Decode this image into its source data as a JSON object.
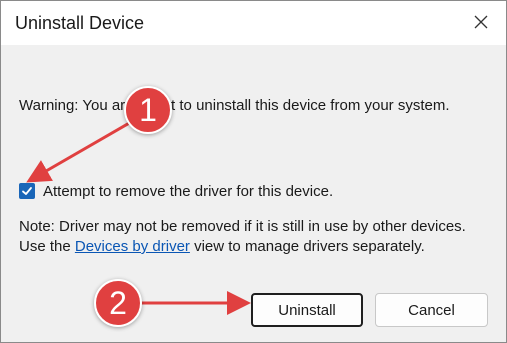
{
  "dialog": {
    "title": "Uninstall Device",
    "warning_text": "Warning: You are about to uninstall this device from your system.",
    "checkbox": {
      "label": "Attempt to remove the driver for this device.",
      "checked": true
    },
    "note": {
      "prefix": "Note: Driver may not be removed if it is still in use by other devices. Use the ",
      "link_text": "Devices by driver",
      "suffix": " view to manage drivers separately."
    },
    "buttons": {
      "uninstall_label": "Uninstall",
      "cancel_label": "Cancel"
    },
    "close_icon": "close-icon"
  },
  "annotations": {
    "badge1": "1",
    "badge2": "2",
    "color": "#e04040"
  }
}
